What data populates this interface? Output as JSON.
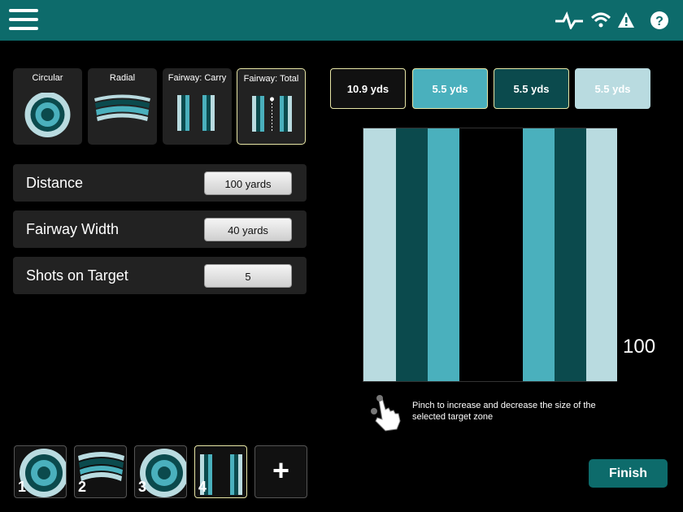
{
  "header": {
    "icons": [
      "menu-icon",
      "activity-icon",
      "wifi-icon",
      "warning-icon",
      "help-icon"
    ]
  },
  "modes": [
    {
      "label": "Circular"
    },
    {
      "label": "Radial"
    },
    {
      "label": "Fairway: Carry"
    },
    {
      "label": "Fairway: Total",
      "selected": true
    }
  ],
  "settings": [
    {
      "label": "Distance",
      "value": "100 yards"
    },
    {
      "label": "Fairway Width",
      "value": "40 yards"
    },
    {
      "label": "Shots on Target",
      "value": "5"
    }
  ],
  "zones": [
    {
      "label": "10.9 yds",
      "bg": "#111111",
      "border": "#e8e6a6",
      "color": "#ffffff"
    },
    {
      "label": "5.5 yds",
      "bg": "#4ab0bd",
      "border": "#e8e6a6",
      "color": "#ffffff"
    },
    {
      "label": "5.5 yds",
      "bg": "#0b4a4d",
      "border": "#e8e6a6",
      "color": "#ffffff"
    },
    {
      "label": "5.5 yds",
      "bg": "#b9dbe0",
      "border": "#b9dbe0",
      "color": "#ffffff"
    }
  ],
  "target": {
    "distance_label": "100",
    "hint": "Pinch to increase and decrease the size of the selected target zone"
  },
  "targets": [
    {
      "num": "1",
      "icon": "circular-target-icon"
    },
    {
      "num": "2",
      "icon": "radial-target-icon"
    },
    {
      "num": "3",
      "icon": "circular-target-icon"
    },
    {
      "num": "4",
      "icon": "fairway-target-icon",
      "selected": true
    }
  ],
  "add_label": "+",
  "finish_label": "Finish",
  "colors": {
    "header": "#0d6b6b",
    "light": "#b9dbe0",
    "mid": "#4ab0bd",
    "dark": "#0b4a4d",
    "selected": "#e8e6a6"
  }
}
